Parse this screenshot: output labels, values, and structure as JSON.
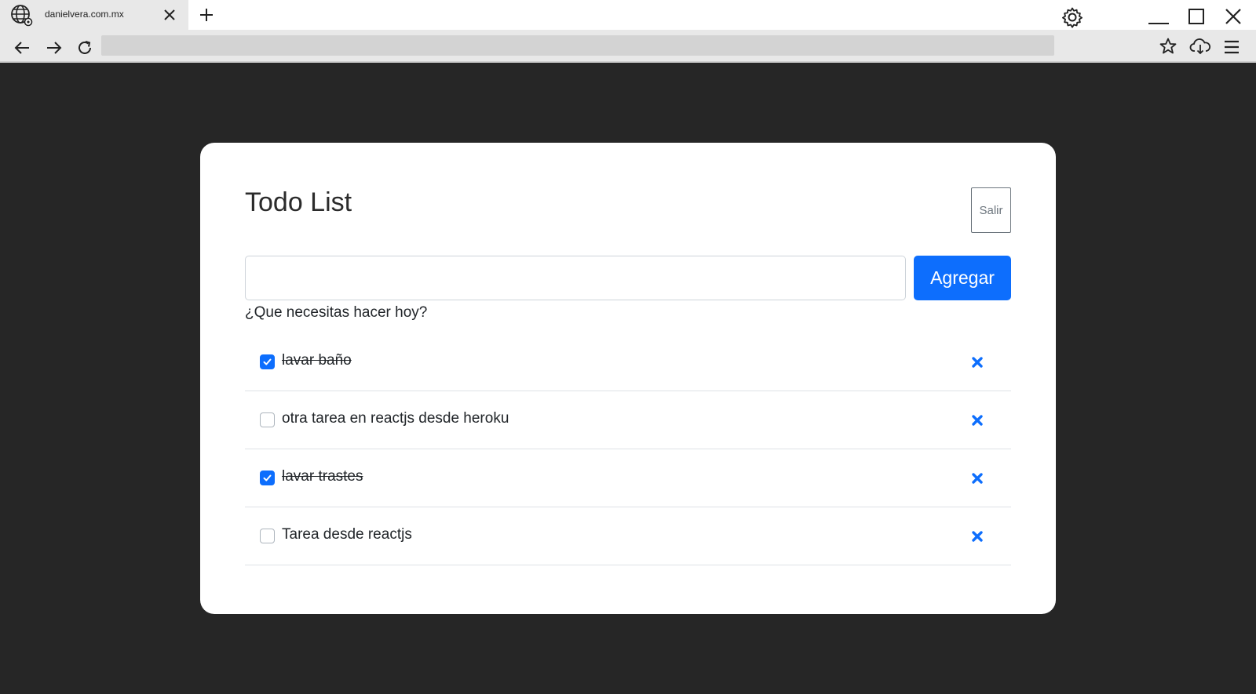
{
  "browser": {
    "tab_title": "danielvera.com.mx",
    "address": ""
  },
  "page": {
    "title": "Todo List",
    "logout_label": "Salir",
    "input_value": "",
    "add_label": "Agregar",
    "helper_text": "¿Que necesitas hacer hoy?"
  },
  "todos": [
    {
      "text": "lavar baño",
      "done": true
    },
    {
      "text": "otra tarea en reactjs desde heroku",
      "done": false
    },
    {
      "text": "lavar trastes",
      "done": true
    },
    {
      "text": "Tarea desde reactjs",
      "done": false
    }
  ],
  "colors": {
    "primary": "#0d6efd",
    "page_background": "#262626",
    "chrome": "#e8e8e8"
  }
}
